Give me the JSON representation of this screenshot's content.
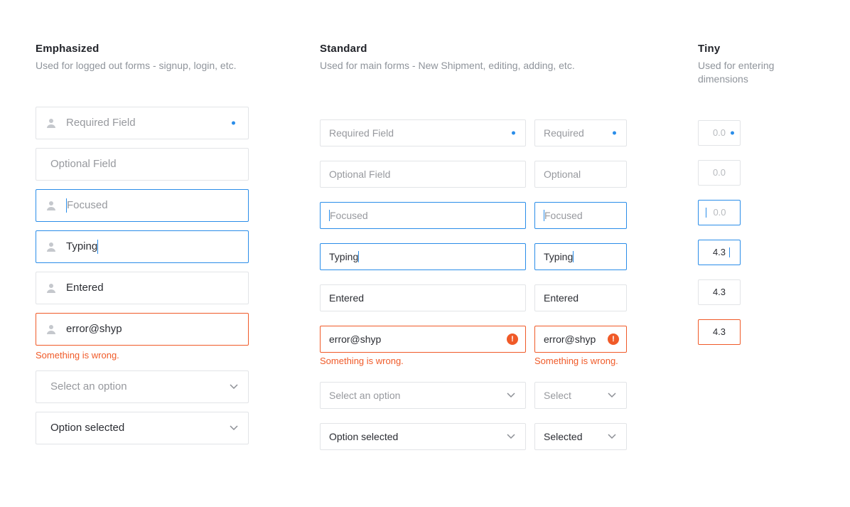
{
  "emphasized": {
    "title": "Emphasized",
    "subhead": "Used for logged out forms - signup, login, etc.",
    "required_ph": "Required Field",
    "optional_ph": "Optional Field",
    "focused_ph": "Focused",
    "typing_val": "Typing",
    "entered_val": "Entered",
    "error_val": "error@shyp",
    "error_msg": "Something is wrong.",
    "select_ph": "Select an option",
    "select_val": "Option selected"
  },
  "standard": {
    "title": "Standard",
    "subhead": "Used for main forms - New Shipment, editing, adding, etc.",
    "wide": {
      "required_ph": "Required Field",
      "optional_ph": "Optional Field",
      "focused_ph": "Focused",
      "typing_val": "Typing",
      "entered_val": "Entered",
      "error_val": "error@shyp",
      "error_msg": "Something is wrong.",
      "select_ph": "Select an option",
      "select_val": "Option selected"
    },
    "narrow": {
      "required_ph": "Required",
      "optional_ph": "Optional",
      "focused_ph": "Focused",
      "typing_val": "Typing",
      "entered_val": "Entered",
      "error_val": "error@shyp",
      "error_msg": "Something is wrong.",
      "select_ph": "Select",
      "select_val": "Selected"
    }
  },
  "tiny": {
    "title": "Tiny",
    "subhead": "Used for entering dimensions",
    "required_ph": "0.0",
    "optional_ph": "0.0",
    "focused_ph": "0.0",
    "typing_val": "4.3",
    "entered_val": "4.3",
    "error_val": "4.3"
  }
}
